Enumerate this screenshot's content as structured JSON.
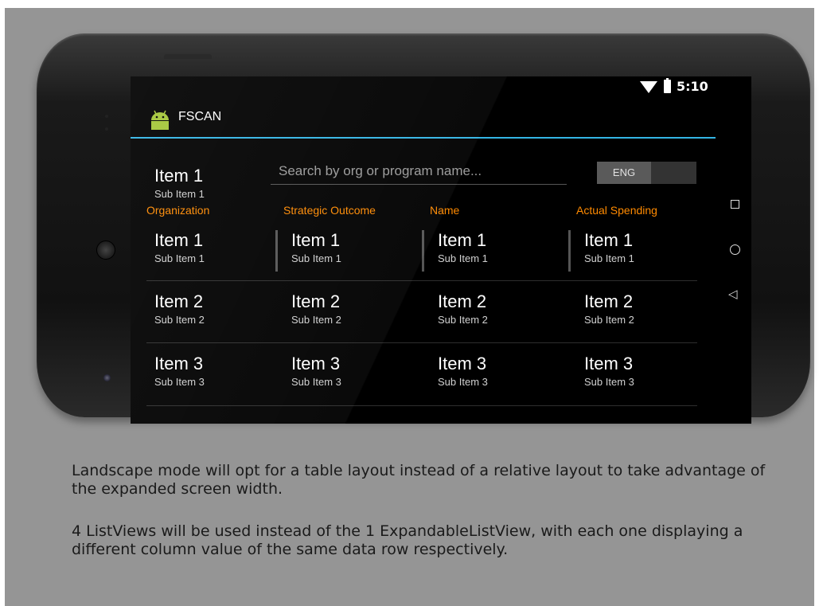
{
  "status_bar": {
    "time": "5:10",
    "icons": [
      "wifi-icon",
      "battery-icon"
    ]
  },
  "action_bar": {
    "app_title": "FSCAN",
    "icon": "android-icon",
    "accent_color": "#33b5e5"
  },
  "nav_bar": {
    "buttons": [
      "recents-square-icon",
      "home-circle-icon",
      "back-triangle-icon"
    ]
  },
  "top_item": {
    "title": "Item 1",
    "subtitle": "Sub Item 1"
  },
  "search": {
    "placeholder": "Search by org or program name..."
  },
  "language_toggle": {
    "label": "ENG"
  },
  "columns": [
    {
      "header": "Organization"
    },
    {
      "header": "Strategic Outcome"
    },
    {
      "header": "Name"
    },
    {
      "header": "Actual Spending"
    }
  ],
  "header_color": "#ff8a00",
  "rows": [
    {
      "cells": [
        {
          "title": "Item 1",
          "subtitle": "Sub Item 1"
        },
        {
          "title": "Item 1",
          "subtitle": "Sub Item 1"
        },
        {
          "title": "Item 1",
          "subtitle": "Sub Item 1"
        },
        {
          "title": "Item 1",
          "subtitle": "Sub Item 1"
        }
      ]
    },
    {
      "cells": [
        {
          "title": "Item 2",
          "subtitle": "Sub Item 2"
        },
        {
          "title": "Item 2",
          "subtitle": "Sub Item 2"
        },
        {
          "title": "Item 2",
          "subtitle": "Sub Item 2"
        },
        {
          "title": "Item 2",
          "subtitle": "Sub Item 2"
        }
      ]
    },
    {
      "cells": [
        {
          "title": "Item 3",
          "subtitle": "Sub Item 3"
        },
        {
          "title": "Item 3",
          "subtitle": "Sub Item 3"
        },
        {
          "title": "Item 3",
          "subtitle": "Sub Item 3"
        },
        {
          "title": "Item 3",
          "subtitle": "Sub Item 3"
        }
      ]
    }
  ],
  "caption": {
    "paragraph1": "Landscape mode will opt for a table layout instead of a relative layout to take advantage of the expanded screen width.",
    "paragraph2": "4 ListViews will be used instead of the 1 ExpandableListView, with each one displaying a different column value of the same data row respectively."
  }
}
